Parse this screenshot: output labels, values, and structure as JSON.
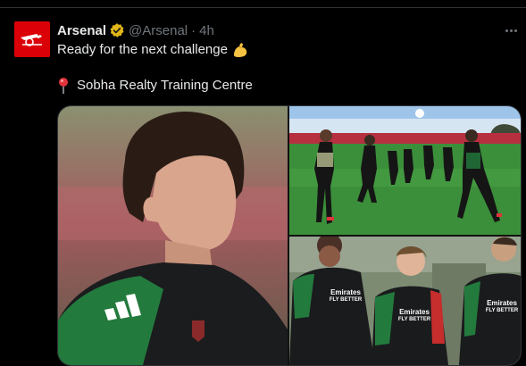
{
  "tweet": {
    "author_name": "Arsenal",
    "handle": "@Arsenal",
    "separator": "·",
    "timestamp": "4h",
    "text_line1": "Ready for the next challenge",
    "location_text": "Sobha Realty Training Centre"
  },
  "kit": {
    "sponsor_line1": "Emirates",
    "sponsor_line2": "FLY BETTER"
  },
  "icons": {
    "avatar": "arsenal-cannon-logo",
    "verified": "gold-verified-badge-icon",
    "more": "more-options-icon",
    "flex": "flexed-biceps-emoji",
    "pin": "round-pushpin-emoji"
  },
  "colors": {
    "brand_red": "#db0007",
    "verified_gold": "#e2b719",
    "muted_text": "#71767b"
  }
}
